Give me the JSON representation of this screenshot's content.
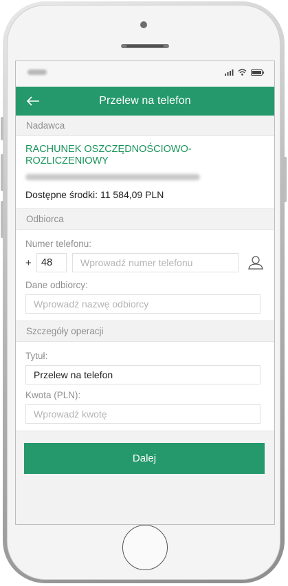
{
  "header": {
    "title": "Przelew na telefon"
  },
  "sender": {
    "section_label": "Nadawca",
    "account_name": "RACHUNEK OSZCZĘDNOŚCIOWO-ROZLICZENIOWY",
    "balance_text": "Dostępne środki: 11 584,09 PLN"
  },
  "recipient": {
    "section_label": "Odbiorca",
    "phone_label": "Numer telefonu:",
    "phone_plus": "+",
    "phone_prefix": "48",
    "phone_placeholder": "Wprowadź numer telefonu",
    "data_label": "Dane odbiorcy:",
    "name_placeholder": "Wprowadź nazwę odbiorcy"
  },
  "details": {
    "section_label": "Szczegóły operacji",
    "title_label": "Tytuł:",
    "title_value": "Przelew na telefon",
    "amount_label": "Kwota (PLN):",
    "amount_placeholder": "Wprowadź kwotę"
  },
  "actions": {
    "next_label": "Dalej"
  },
  "colors": {
    "accent": "#25996c",
    "account_text": "#179459",
    "background": "#f2f2f2"
  },
  "icons": [
    "back-arrow-icon",
    "contact-person-icon",
    "signal-icon",
    "wifi-icon",
    "battery-icon"
  ]
}
